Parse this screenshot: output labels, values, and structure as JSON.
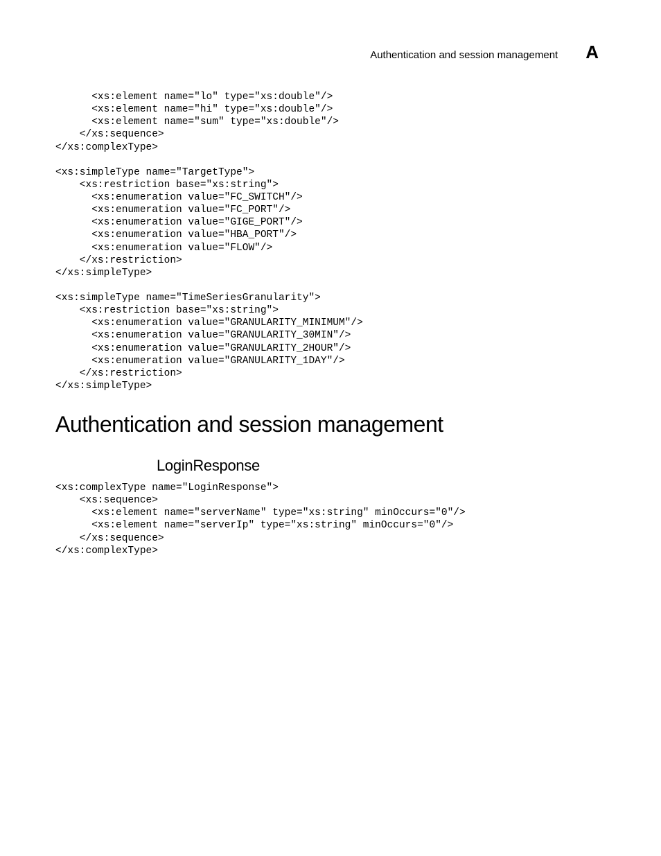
{
  "header": {
    "title": "Authentication and session management",
    "letter": "A"
  },
  "code1": "      <xs:element name=\"lo\" type=\"xs:double\"/>\n      <xs:element name=\"hi\" type=\"xs:double\"/>\n      <xs:element name=\"sum\" type=\"xs:double\"/>\n    </xs:sequence>\n</xs:complexType>\n\n<xs:simpleType name=\"TargetType\">\n    <xs:restriction base=\"xs:string\">\n      <xs:enumeration value=\"FC_SWITCH\"/>\n      <xs:enumeration value=\"FC_PORT\"/>\n      <xs:enumeration value=\"GIGE_PORT\"/>\n      <xs:enumeration value=\"HBA_PORT\"/>\n      <xs:enumeration value=\"FLOW\"/>\n    </xs:restriction>\n</xs:simpleType>\n\n<xs:simpleType name=\"TimeSeriesGranularity\">\n    <xs:restriction base=\"xs:string\">\n      <xs:enumeration value=\"GRANULARITY_MINIMUM\"/>\n      <xs:enumeration value=\"GRANULARITY_30MIN\"/>\n      <xs:enumeration value=\"GRANULARITY_2HOUR\"/>\n      <xs:enumeration value=\"GRANULARITY_1DAY\"/>\n    </xs:restriction>\n</xs:simpleType>",
  "section_heading": "Authentication and session management",
  "subsection_heading": "LoginResponse",
  "code2": "<xs:complexType name=\"LoginResponse\">\n    <xs:sequence>\n      <xs:element name=\"serverName\" type=\"xs:string\" minOccurs=\"0\"/>\n      <xs:element name=\"serverIp\" type=\"xs:string\" minOccurs=\"0\"/>\n    </xs:sequence>\n</xs:complexType>"
}
